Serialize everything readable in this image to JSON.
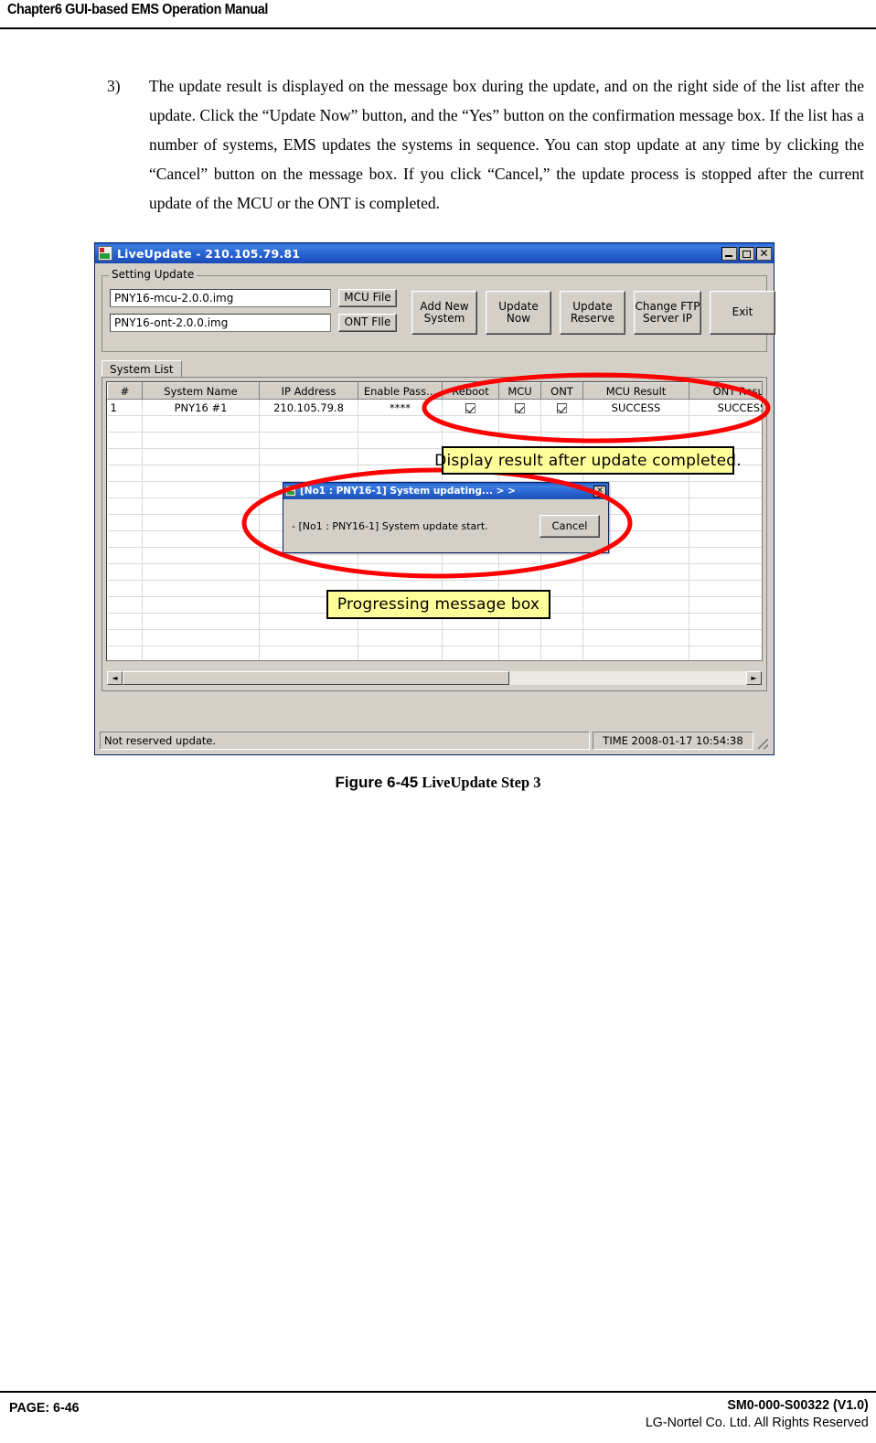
{
  "page": {
    "header_title": "Chapter6 GUI-based EMS Operation Manual",
    "footer_page": "PAGE: 6-46",
    "footer_doc_id": "SM0-000-S00322 (V1.0)",
    "footer_rights": "LG-Nortel Co. Ltd. All Rights Reserved"
  },
  "body": {
    "item_marker": "3)",
    "item_text": "The update result is displayed on the message box during the update, and on the right side of the list after the update. Click the “Update Now” button, and the “Yes” button on the confirmation message box. If the list has a number of systems, EMS updates the systems in sequence. You can stop update at any time by clicking the “Cancel” button on the message box. If you click “Cancel,” the update process is stopped after the current update of the MCU or the ONT is completed."
  },
  "figure": {
    "caption_lead": "Figure 6-45",
    "caption_rest": "LiveUpdate Step 3"
  },
  "app": {
    "title": "LiveUpdate - 210.105.79.81",
    "window_buttons": {
      "minimize": "_",
      "maximize": "□",
      "close": "✕"
    },
    "setting_group": {
      "legend": "Setting Update",
      "mcu_file_value": "PNY16-mcu-2.0.0.img",
      "ont_file_value": "PNY16-ont-2.0.0.img",
      "mcu_file_button": "MCU File",
      "ont_file_button": "ONT FIle"
    },
    "actions": [
      {
        "line1": "Add New",
        "line2": "System"
      },
      {
        "line1": "Update",
        "line2": "Now"
      },
      {
        "line1": "Update",
        "line2": "Reserve"
      },
      {
        "line1": "Change FTP",
        "line2": "Server IP"
      },
      {
        "line1": "Exit",
        "line2": ""
      }
    ],
    "tab": {
      "label": "System List"
    },
    "grid": {
      "columns": [
        "#",
        "System Name",
        "IP Address",
        "Enable Pass...",
        "Reboot",
        "MCU",
        "ONT",
        "MCU Result",
        "ONT Result"
      ],
      "rows": [
        {
          "index": "1",
          "system_name": "PNY16 #1",
          "ip_address": "210.105.79.8",
          "enable_pass": "****",
          "reboot_checked": true,
          "mcu_checked": true,
          "ont_checked": true,
          "mcu_result": "SUCCESS",
          "ont_result": "SUCCESS"
        }
      ],
      "empty_row_count": 15
    },
    "scrollbar": {
      "left_arrow": "◄",
      "right_arrow": "►"
    },
    "statusbar": {
      "left_text": "Not reserved update.",
      "right_text": "TIME 2008-01-17 10:54:38"
    },
    "modal": {
      "title": "[No1 : PNY16-1] System updating... > >",
      "close_label": "✕",
      "message": "- [No1 : PNY16-1] System update start.",
      "cancel_label": "Cancel"
    }
  },
  "annotations": {
    "callout_result": "Display result after update completed.",
    "callout_progress": "Progressing message box",
    "highlight_color": "#FF0000",
    "callout_bg": "#FFFF99"
  }
}
